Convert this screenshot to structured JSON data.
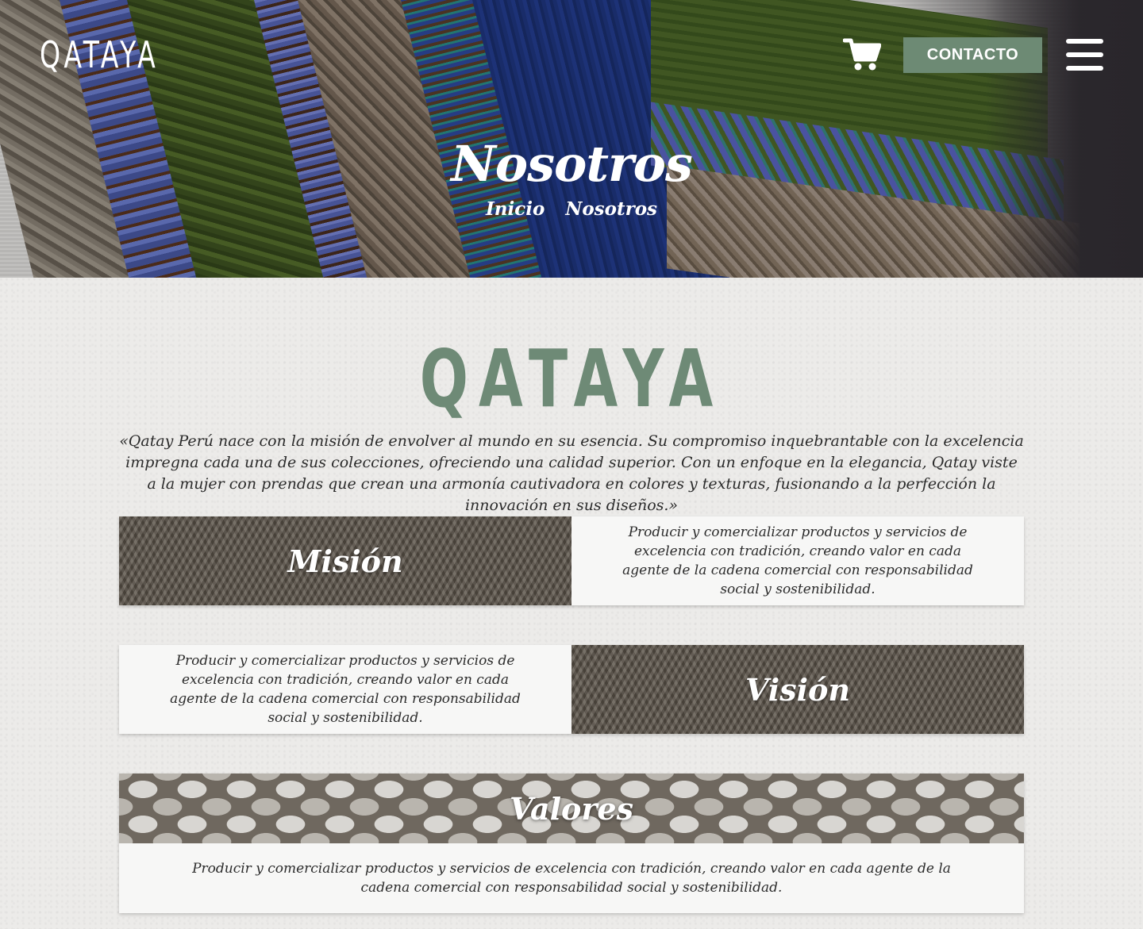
{
  "header": {
    "logo": "QATAYA",
    "contact_label": "CONTACTO",
    "cart_icon": "shopping-cart-icon",
    "menu_icon": "hamburger-menu-icon"
  },
  "hero": {
    "title": "Nosotros",
    "breadcrumb": [
      "Inicio",
      "Nosotros"
    ]
  },
  "about": {
    "brand": "QATAYA",
    "quote": "«Qatay Perú nace con la misión de envolver al mundo en su esencia. Su compromiso inquebrantable con la excelencia impregna cada una de sus colecciones, ofreciendo una calidad superior. Con un enfoque en la elegancia, Qatay viste a la mujer con prendas que crean una armonía cautivadora en colores y texturas, fusionando a la perfección la innovación en sus diseños.»"
  },
  "mision": {
    "title": "Misión",
    "text": "Producir y comercializar productos y servicios de excelencia con tradición, creando valor en cada agente de la cadena comercial con responsabilidad social y sostenibilidad."
  },
  "vision": {
    "title": "Visión",
    "text": "Producir y comercializar productos y servicios de excelencia con tradición, creando valor en cada agente de la cadena comercial con responsabilidad social y sostenibilidad."
  },
  "valores": {
    "title": "Valores",
    "text": "Producir y comercializar productos y servicios de excelencia con tradición, creando valor en cada agente de la cadena comercial con responsabilidad social y sostenibilidad."
  },
  "colors": {
    "accent": "#6e8a76",
    "button": "#6d8a74",
    "page_bg": "#ecebe9",
    "panel_bg": "#f7f7f6"
  }
}
